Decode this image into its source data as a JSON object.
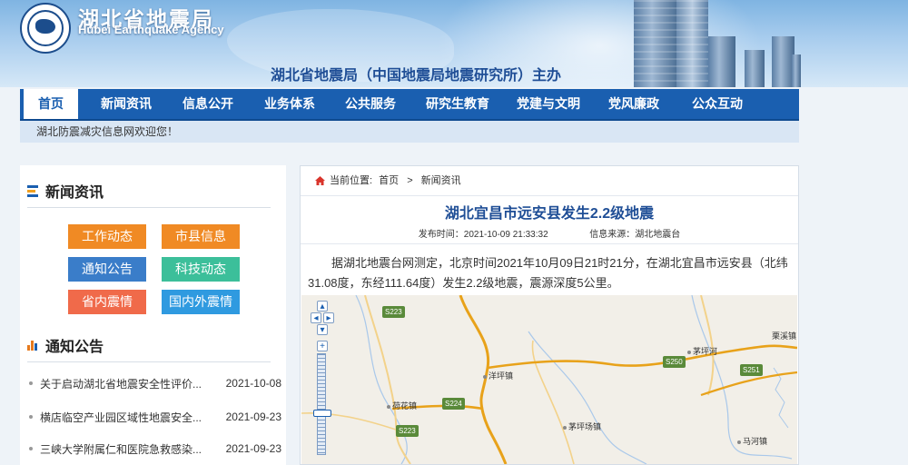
{
  "header": {
    "name_cn": "湖北省地震局",
    "name_en": "Hubei Earthquake Agency",
    "host": "湖北省地震局（中国地震局地震研究所）主办"
  },
  "nav": {
    "items": [
      "首页",
      "新闻资讯",
      "信息公开",
      "业务体系",
      "公共服务",
      "研究生教育",
      "党建与文明",
      "党风廉政",
      "公众互动"
    ],
    "active": "首页"
  },
  "welcome": "湖北防震减灾信息网欢迎您！",
  "sidebar": {
    "news_title": "新闻资讯",
    "tags": [
      {
        "label": "工作动态",
        "color": "#f08a24"
      },
      {
        "label": "市县信息",
        "color": "#f08a24"
      },
      {
        "label": "通知公告",
        "color": "#3a7dc9"
      },
      {
        "label": "科技动态",
        "color": "#3cbf9a"
      },
      {
        "label": "省内震情",
        "color": "#f06a4a"
      },
      {
        "label": "国内外震情",
        "color": "#2f9ae0"
      }
    ],
    "notice_title": "通知公告",
    "notices": [
      {
        "title": "关于启动湖北省地震安全性评价...",
        "date": "2021-10-08"
      },
      {
        "title": "横店临空产业园区域性地震安全...",
        "date": "2021-09-23"
      },
      {
        "title": "三峡大学附属仁和医院急救感染...",
        "date": "2021-09-23"
      }
    ]
  },
  "article": {
    "crumb_label": "当前位置:",
    "crumb_home": "首页",
    "crumb_sep": ">",
    "crumb_section": "新闻资讯",
    "title": "湖北宜昌市远安县发生2.2级地震",
    "publish_label": "发布时间：",
    "publish_time": "2021-10-09 21:33:32",
    "source_label": "信息来源：",
    "source": "湖北地震台",
    "body": "据湖北地震台网测定，北京时间2021年10月09日21时21分，在湖北宜昌市远安县（北纬31.08度，东经111.64度）发生2.2级地震，震源深度5公里。"
  },
  "map": {
    "roads": [
      "S223",
      "S224",
      "S223",
      "S250",
      "S251"
    ],
    "places": [
      "洋坪镇",
      "荷花镇",
      "茅坪场镇",
      "茅坪河",
      "马河镇",
      "栗溪镇"
    ]
  },
  "colors": {
    "nav": "#1a5fb0",
    "title": "#1f4e96",
    "road": "#f0b93a",
    "road_major": "#e8a21a"
  }
}
